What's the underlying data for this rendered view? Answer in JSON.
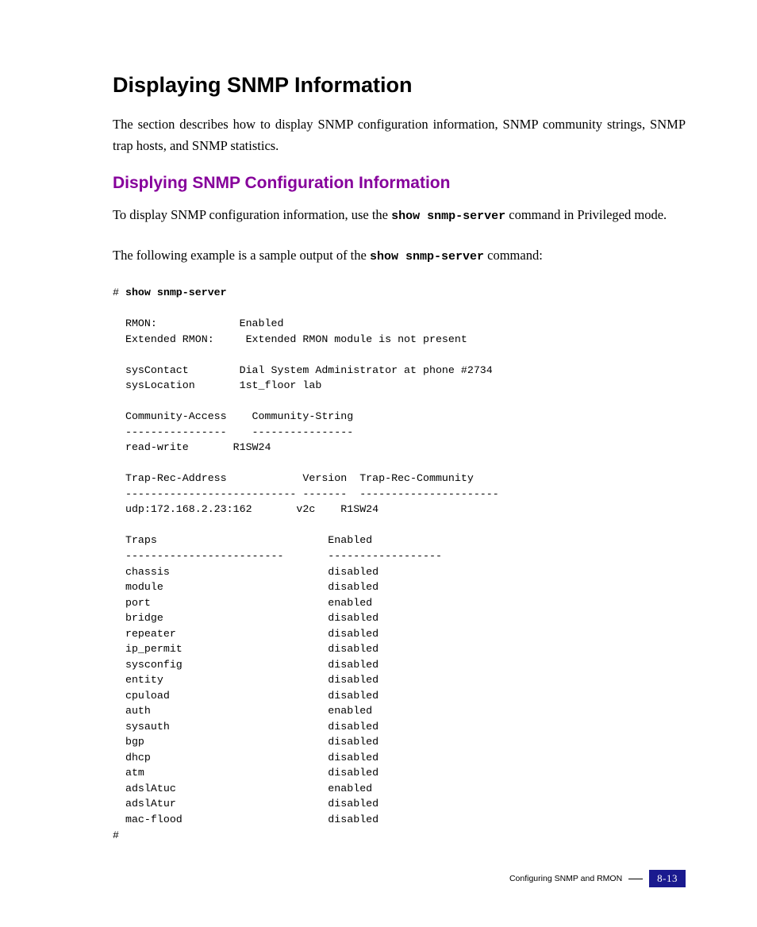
{
  "heading_main": "Displaying SNMP Information",
  "intro_paragraph": "The section describes how to display SNMP configuration information, SNMP community strings, SNMP trap hosts, and SNMP statistics.",
  "heading_sub": "Displying SNMP Configuration Information",
  "para1_pre": "To display SNMP configuration information, use the ",
  "para1_code": "show snmp-server",
  "para1_post": " command in Privileged mode.",
  "para2_pre": "The following example is a sample output of the ",
  "para2_code": "show snmp-server",
  "para2_post": " command:",
  "term_prompt": "# ",
  "term_cmd": "show snmp-server",
  "snmp": {
    "rmon_label": "RMON:",
    "rmon_value": "Enabled",
    "ext_rmon_label": "Extended RMON:",
    "ext_rmon_value": "Extended RMON module is not present",
    "syscontact_label": "sysContact",
    "syscontact_value": "Dial System Administrator at phone #2734",
    "syslocation_label": "sysLocation",
    "syslocation_value": "1st_floor lab",
    "community_access_hdr": "Community-Access",
    "community_string_hdr": "Community-String",
    "community_dash1": "----------------",
    "community_dash2": "----------------",
    "community_access_val": "read-write",
    "community_string_val": "R1SW24",
    "trap_addr_hdr": "Trap-Rec-Address",
    "trap_ver_hdr": "Version",
    "trap_comm_hdr": "Trap-Rec-Community",
    "trap_dash1": "---------------------------",
    "trap_dash2": "-------",
    "trap_dash3": "----------------------",
    "trap_addr_val": "udp:172.168.2.23:162",
    "trap_ver_val": "v2c",
    "trap_comm_val": "R1SW24",
    "traps_hdr": "Traps",
    "enabled_hdr": "Enabled",
    "traps_dash1": "-------------------------",
    "traps_dash2": "------------------",
    "traps": [
      {
        "name": "chassis",
        "state": "disabled"
      },
      {
        "name": "module",
        "state": "disabled"
      },
      {
        "name": "port",
        "state": "enabled"
      },
      {
        "name": "bridge",
        "state": "disabled"
      },
      {
        "name": "repeater",
        "state": "disabled"
      },
      {
        "name": "ip_permit",
        "state": "disabled"
      },
      {
        "name": "sysconfig",
        "state": "disabled"
      },
      {
        "name": "entity",
        "state": "disabled"
      },
      {
        "name": "cpuload",
        "state": "disabled"
      },
      {
        "name": "auth",
        "state": "enabled"
      },
      {
        "name": "sysauth",
        "state": "disabled"
      },
      {
        "name": "bgp",
        "state": "disabled"
      },
      {
        "name": "dhcp",
        "state": "disabled"
      },
      {
        "name": "atm",
        "state": "disabled"
      },
      {
        "name": "adslAtuc",
        "state": "enabled"
      },
      {
        "name": "adslAtur",
        "state": "disabled"
      },
      {
        "name": "mac-flood",
        "state": "disabled"
      }
    ],
    "end_prompt": "#"
  },
  "footer_text": "Configuring SNMP and RMON",
  "footer_page": "8-13"
}
